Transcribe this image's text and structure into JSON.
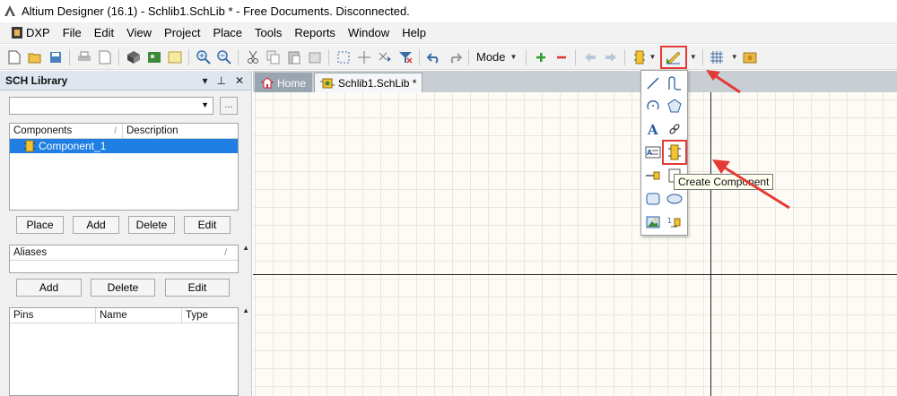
{
  "window": {
    "title": "Altium Designer (16.1) - Schlib1.SchLib * - Free Documents. Disconnected."
  },
  "menubar": {
    "items": [
      "DXP",
      "File",
      "Edit",
      "View",
      "Project",
      "Place",
      "Tools",
      "Reports",
      "Window",
      "Help"
    ]
  },
  "toolbar": {
    "mode_label": "Mode"
  },
  "panel": {
    "title": "SCH Library",
    "components": {
      "headers": [
        "Components",
        "Description"
      ],
      "rows": [
        {
          "name": "Component_1",
          "description": "",
          "selected": true
        }
      ]
    },
    "component_buttons": [
      "Place",
      "Add",
      "Delete",
      "Edit"
    ],
    "aliases": {
      "header": "Aliases"
    },
    "alias_buttons": [
      "Add",
      "Delete",
      "Edit"
    ],
    "pins": {
      "headers": [
        "Pins",
        "Name",
        "Type"
      ]
    }
  },
  "tabs": [
    {
      "label": "Home",
      "active": false
    },
    {
      "label": "Schlib1.SchLib *",
      "active": true
    }
  ],
  "dropdown": {
    "items": [
      "line-icon",
      "bezier-icon",
      "arc-icon",
      "polygon-icon",
      "text-icon",
      "link-icon",
      "textframe-icon",
      "create-component-icon",
      "pin-icon",
      "rectangle-icon",
      "rounded-rectangle-icon",
      "ellipse-icon",
      "image-icon",
      "ieee-symbol-icon"
    ],
    "tooltip": "Create Component"
  },
  "colors": {
    "highlight": "#e53935",
    "selection": "#1f7fe3",
    "canvas": "#fdfbf5"
  }
}
